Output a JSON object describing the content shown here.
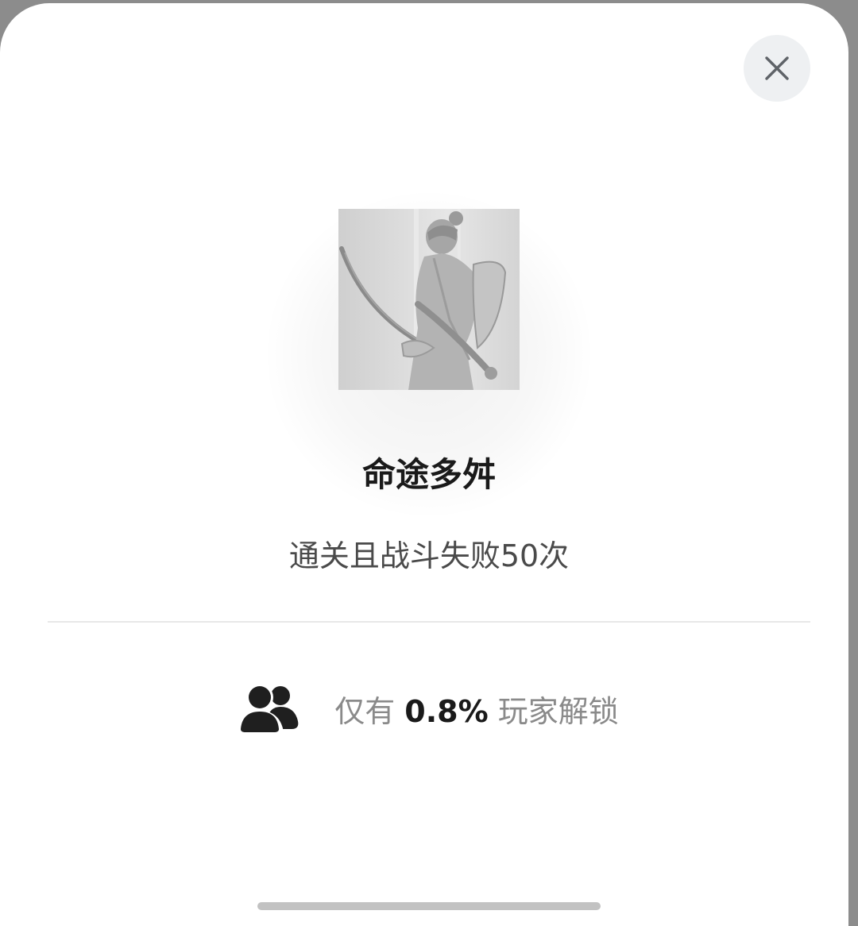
{
  "achievement": {
    "title": "命途多舛",
    "description": "通关且战斗失败50次",
    "badge_icon": "samurai-archer-badge",
    "locked": true
  },
  "stats": {
    "prefix": "仅有",
    "percent": "0.8%",
    "suffix": "玩家解锁",
    "icon": "users-icon"
  },
  "close": {
    "icon": "close-icon"
  },
  "colors": {
    "title": "#1a1a1a",
    "description": "#4a4a4a",
    "stat_muted": "#8a8a8a",
    "close_bg": "#eef0f2"
  }
}
